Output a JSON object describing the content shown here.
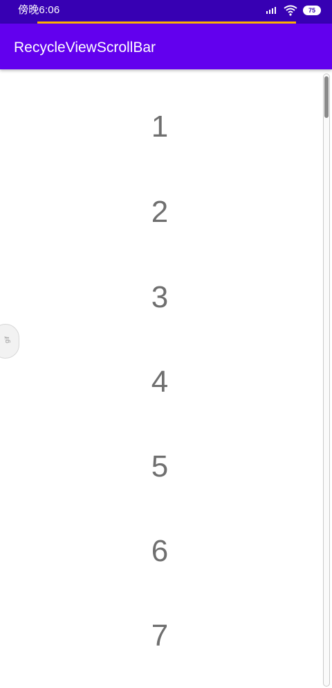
{
  "status_bar": {
    "time": "傍晚6:06",
    "battery": "75",
    "signal_icon": "signal-icon",
    "wifi_icon": "wifi-icon",
    "battery_icon": "battery-icon"
  },
  "app_bar": {
    "title": "RecycleViewScrollBar",
    "color": "#6200EE"
  },
  "list": {
    "items": [
      "1",
      "2",
      "3",
      "4",
      "5",
      "6",
      "7"
    ]
  },
  "side_handle": {
    "label": "gif",
    "icon": "gif-handle-icon"
  },
  "scrollbar": {
    "position": 0
  },
  "colors": {
    "status_bar": "#3700B3",
    "app_bar": "#6200EE",
    "item_text": "#6f6f6f"
  }
}
